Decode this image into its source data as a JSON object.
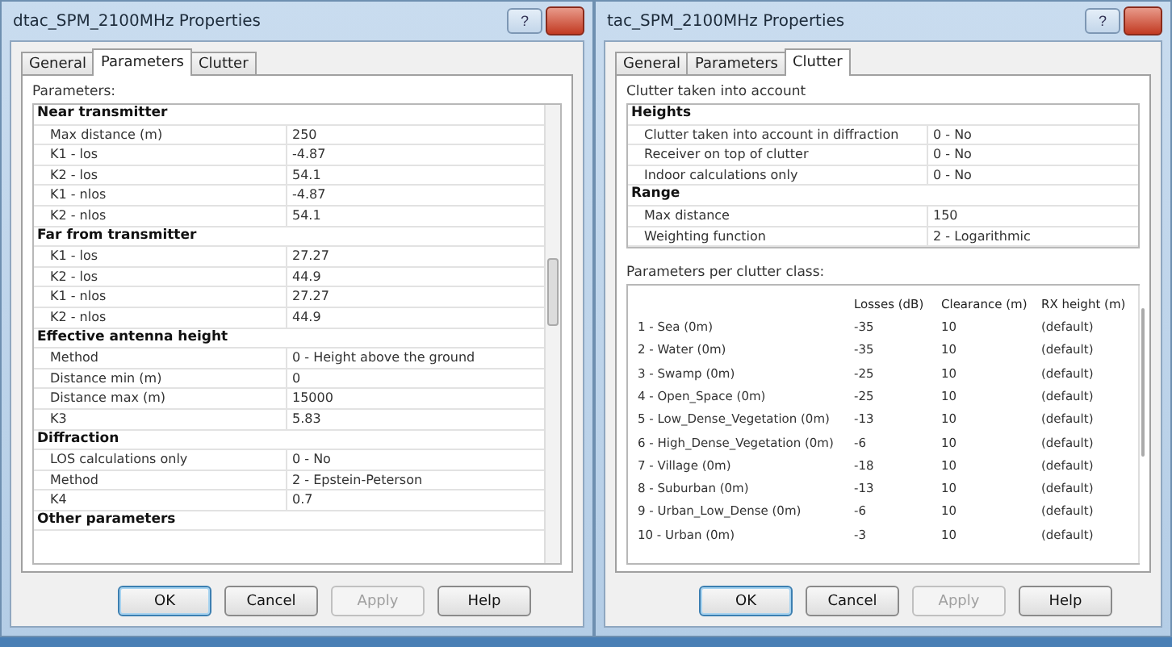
{
  "windows": [
    {
      "title": "dtac_SPM_2100MHz Properties",
      "help": "?",
      "tabs": [
        {
          "label": "General",
          "selected": false
        },
        {
          "label": "Parameters",
          "selected": true
        },
        {
          "label": "Clutter",
          "selected": false
        }
      ],
      "section_label": "Parameters:",
      "groups": [
        {
          "title": "Near transmitter",
          "rows": [
            {
              "name": "Max distance (m)",
              "value": "250"
            },
            {
              "name": "K1 - los",
              "value": "-4.87"
            },
            {
              "name": "K2 - los",
              "value": "54.1"
            },
            {
              "name": "K1 - nlos",
              "value": "-4.87"
            },
            {
              "name": "K2 - nlos",
              "value": "54.1"
            }
          ]
        },
        {
          "title": "Far from transmitter",
          "rows": [
            {
              "name": "K1 - los",
              "value": "27.27"
            },
            {
              "name": "K2 - los",
              "value": "44.9"
            },
            {
              "name": "K1 - nlos",
              "value": "27.27"
            },
            {
              "name": "K2 - nlos",
              "value": "44.9"
            }
          ]
        },
        {
          "title": "Effective antenna height",
          "rows": [
            {
              "name": "Method",
              "value": "0 - Height above the ground"
            },
            {
              "name": "Distance min (m)",
              "value": "0"
            },
            {
              "name": "Distance max (m)",
              "value": "15000"
            },
            {
              "name": "K3",
              "value": "5.83"
            }
          ]
        },
        {
          "title": "Diffraction",
          "rows": [
            {
              "name": "LOS calculations only",
              "value": "0 - No"
            },
            {
              "name": "Method",
              "value": "2 - Epstein-Peterson"
            },
            {
              "name": "K4",
              "value": "0.7"
            }
          ]
        },
        {
          "title": "Other parameters"
        }
      ],
      "buttons": [
        {
          "label": "OK",
          "disabled": false
        },
        {
          "label": "Cancel",
          "disabled": false
        },
        {
          "label": "Apply",
          "disabled": true
        },
        {
          "label": "Help",
          "disabled": false
        }
      ]
    },
    {
      "title": "tac_SPM_2100MHz Properties",
      "help": "?",
      "tabs": [
        {
          "label": "General",
          "selected": false
        },
        {
          "label": "Parameters",
          "selected": false
        },
        {
          "label": "Clutter",
          "selected": true
        }
      ],
      "section_label": "Clutter taken into account",
      "groups": [
        {
          "title": "Heights",
          "rows": [
            {
              "name": "Clutter taken into account in diffraction",
              "value": "0 - No"
            },
            {
              "name": "Receiver on top of clutter",
              "value": "0 - No"
            },
            {
              "name": "Indoor calculations only",
              "value": "0 - No"
            }
          ]
        },
        {
          "title": "Range",
          "rows": [
            {
              "name": "Max distance",
              "value": "150"
            },
            {
              "name": "Weighting function",
              "value": "2 - Logarithmic"
            }
          ]
        }
      ],
      "list": {
        "label": "Parameters per clutter class:",
        "columns": [
          "Losses (dB)",
          "Clearance (m)",
          "RX height (m)"
        ],
        "rows": [
          {
            "class": "1 - Sea (0m)",
            "losses": "-35",
            "clearance": "10",
            "rx_height": "(default)"
          },
          {
            "class": "2 - Water (0m)",
            "losses": "-35",
            "clearance": "10",
            "rx_height": "(default)"
          },
          {
            "class": "3 - Swamp (0m)",
            "losses": "-25",
            "clearance": "10",
            "rx_height": "(default)"
          },
          {
            "class": "4 - Open_Space (0m)",
            "losses": "-25",
            "clearance": "10",
            "rx_height": "(default)"
          },
          {
            "class": "5 - Low_Dense_Vegetation  (0m)",
            "losses": "-13",
            "clearance": "10",
            "rx_height": "(default)"
          },
          {
            "class": "6 - High_Dense_Vegetation (0m)",
            "losses": "-6",
            "clearance": "10",
            "rx_height": "(default)"
          },
          {
            "class": "7 - Village (0m)",
            "losses": "-18",
            "clearance": "10",
            "rx_height": "(default)"
          },
          {
            "class": "8 - Suburban (0m)",
            "losses": "-13",
            "clearance": "10",
            "rx_height": "(default)"
          },
          {
            "class": "9 - Urban_Low_Dense (0m)",
            "losses": "-6",
            "clearance": "10",
            "rx_height": "(default)"
          },
          {
            "class": "10 - Urban (0m)",
            "losses": "-3",
            "clearance": "10",
            "rx_height": "(default)"
          }
        ]
      },
      "buttons": [
        {
          "label": "OK",
          "disabled": false
        },
        {
          "label": "Cancel",
          "disabled": false
        },
        {
          "label": "Apply",
          "disabled": true
        },
        {
          "label": "Help",
          "disabled": false
        }
      ]
    }
  ]
}
